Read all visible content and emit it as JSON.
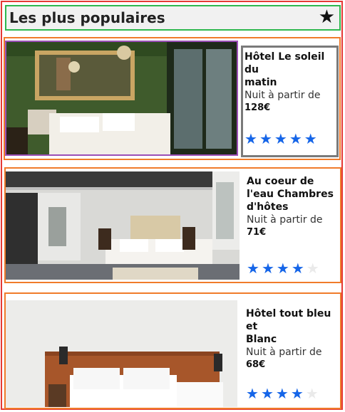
{
  "header": {
    "title": "Les plus populaires",
    "icon": "star-icon"
  },
  "hotels": [
    {
      "name_line1": "Hôtel Le soleil du",
      "name_line2": "matin",
      "from": "Nuit à partir de",
      "price": "128€",
      "rating": 5
    },
    {
      "name_line1": "Au coeur de l'eau Chambres d'hôtes",
      "name_line2": "",
      "from": "Nuit à partir de",
      "price": "71€",
      "rating": 4
    },
    {
      "name_line1": "Hôtel tout bleu et",
      "name_line2": "Blanc",
      "from": "Nuit à partir de",
      "price": "68€",
      "rating": 4
    }
  ],
  "colors": {
    "star_active": "#1565e8",
    "star_inactive": "#eaeaea",
    "card_border": "#f07b2a",
    "header_border": "#2eb84f"
  }
}
